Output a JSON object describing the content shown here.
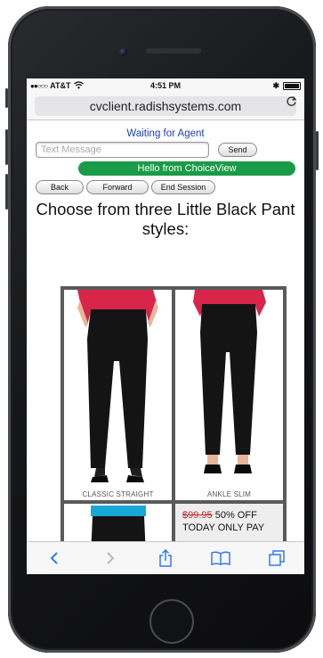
{
  "status_bar": {
    "carrier": "AT&T",
    "time": "4:51 PM"
  },
  "browser": {
    "url": "cvclient.radishsystems.com"
  },
  "chat": {
    "agent_status": "Waiting for Agent",
    "message_placeholder": "Text Message",
    "send_label": "Send",
    "greeting": "Hello from ChoiceView"
  },
  "nav": {
    "back": "Back",
    "forward": "Forward",
    "end_session": "End Session"
  },
  "page": {
    "heading": "Choose from three Little Black Pant styles:",
    "products": [
      {
        "label": "CLASSIC STRAIGHT"
      },
      {
        "label": "ANKLE SLIM"
      }
    ],
    "offer": {
      "old_price": "$99.95",
      "text": "50% OFF TODAY ONLY PAY"
    }
  },
  "colors": {
    "green": "#1a9b47",
    "agent_blue": "#1f3fb0",
    "ios_blue": "#3478f6",
    "red": "#c0282a",
    "turquoise": "#17a8d6"
  }
}
